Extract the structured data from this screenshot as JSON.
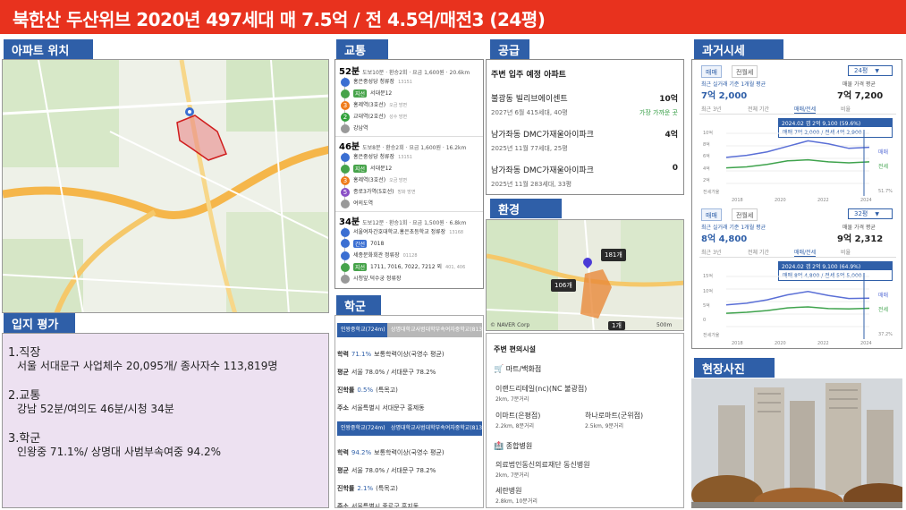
{
  "title": "북한산 두산위브 2020년 497세대 매 7.5억 / 전 4.5억/매전3 (24평)",
  "colors": {
    "title_bg": "#e8321e",
    "header_bg": "#2f5fa8",
    "eval_bg": "#ede1f1"
  },
  "location": {
    "header": "아파트 위치",
    "map_icons": [
      "road-map",
      "red-area-marker",
      "pin-icon"
    ]
  },
  "eval": {
    "header": "입지 평가",
    "job_head": "1.직장",
    "job_text": "서울 서대문구 사업체수 20,095개/ 종사자수 113,819명",
    "traffic_head": "2.교통",
    "traffic_text": "강남 52분/여의도  46분/시청  34분",
    "school_head": "3.학군",
    "school_text": "인왕중  71.1%/ 상명대 사범부속여중  94.2%"
  },
  "transport": {
    "header": "교통",
    "routes": [
      {
        "time": "52분",
        "meta": "도보10분 · 환승2회 · 요금 1,600원 · 20.6km",
        "steps": [
          {
            "n": "",
            "text": "홍은중성당 청류장",
            "sub": "13151",
            "color": "#3b6fd2"
          },
          {
            "n": "",
            "text": "서대문12",
            "sub": "",
            "color": "#46a34a",
            "tag": "지선"
          },
          {
            "n": "3",
            "text": "홍제역(3호선)",
            "sub": "오금 방면",
            "color": "#ef7c1c"
          },
          {
            "n": "2",
            "text": "교대역(2호선)",
            "sub": "성수 방면",
            "color": "#33a23d"
          },
          {
            "n": "",
            "text": "강남역",
            "sub": "",
            "color": "#999"
          }
        ]
      },
      {
        "time": "46분",
        "meta": "도보8분 · 환승2회 · 요금 1,600원 · 16.2km",
        "steps": [
          {
            "n": "",
            "text": "홍은중성당 청류장",
            "sub": "13151",
            "color": "#3b6fd2"
          },
          {
            "n": "",
            "text": "서대문12",
            "sub": "",
            "color": "#46a34a",
            "tag": "지선"
          },
          {
            "n": "3",
            "text": "홍제역(3호선)",
            "sub": "오금 방면",
            "color": "#ef7c1c"
          },
          {
            "n": "5",
            "text": "종로3가역(5호선)",
            "sub": "방화 방면",
            "color": "#8a4fc6"
          },
          {
            "n": "",
            "text": "여의도역",
            "sub": "",
            "color": "#999"
          }
        ]
      },
      {
        "time": "34분",
        "meta": "도보12분 · 환승1회 · 요금 1,500원 · 6.8km",
        "steps": [
          {
            "n": "",
            "text": "서울여자간호대학교.홍은초등학교 정류장",
            "sub": "13168",
            "color": "#3b6fd2"
          },
          {
            "n": "",
            "text": "7018",
            "sub": "",
            "color": "#3b6fd2",
            "tag": "간선"
          },
          {
            "n": "",
            "text": "세종문화회관 정류장",
            "sub": "01128",
            "color": "#3b6fd2"
          },
          {
            "n": "",
            "text": "1711, 7016, 7022, 7212 외",
            "sub": "401, 406",
            "color": "#46a34a",
            "tag": "지선"
          },
          {
            "n": "",
            "text": "시청앞.덕수궁 정류장",
            "sub": "",
            "color": "#999"
          }
        ]
      }
    ]
  },
  "school": {
    "header": "학군",
    "blocks": [
      {
        "tab1": "인왕중학교(724m)",
        "tab2": "상명대학교사범대학부속여자중학교(813m)",
        "rate_label": "학력",
        "rate": "71.1%",
        "rate_desc": "보통학력이상(국영수 평균)",
        "avg_label": "평균",
        "avg": "서울 78.0% / 서대문구 78.2%",
        "adv_label": "진학률",
        "adv": "0.5%",
        "adv_desc": "(특목고)",
        "addr_label": "주소",
        "addr": "서울특별시 서대문구 홍제동"
      },
      {
        "tab1": "인왕중학교(724m)",
        "tab2": "상명대학교사범대학부속여자중학교(813m)",
        "rate_label": "학력",
        "rate": "94.2%",
        "rate_desc": "보통학력이상(국영수 평균)",
        "avg_label": "평균",
        "avg": "서울 78.0% / 서대문구 78.2%",
        "adv_label": "진학률",
        "adv": "2.1%",
        "adv_desc": "(특목고)",
        "addr_label": "주소",
        "addr": "서울특별시 종로구 홍지동"
      }
    ]
  },
  "supply": {
    "header": "공급",
    "subtitle": "주변 입주 예정 아파트",
    "items": [
      {
        "name": "불광동 빌리브에이센트",
        "count": "10억",
        "date": "2027년 6월 415세대, 40평",
        "note": "가장 가까운 곳"
      },
      {
        "name": "남가좌동 DMC가재울아이파크",
        "count": "4억",
        "date": "2025년 11월 77세대, 25평",
        "note": ""
      },
      {
        "name": "남가좌동 DMC가재울아이파크",
        "count": "0",
        "date": "2025년 11월 283세대, 33평",
        "note": ""
      }
    ]
  },
  "env": {
    "header": "환경",
    "map_labels": {
      "c1": "181개",
      "c2": "106개",
      "c3": "1개",
      "naver": "© NAVER Corp",
      "scale": "500m"
    },
    "conv_title": "주변 편의시설",
    "mart_label": "마트/백화점",
    "marts": [
      {
        "name": "이랜드리테일(nc)(NC 불광점)",
        "dist": "2km, 7분거리"
      },
      {
        "name": "이마트(은평점)",
        "dist": "2.2km, 8분거리"
      },
      {
        "name": "하나로마트(군위점)",
        "dist": "2.5km, 9분거리"
      }
    ],
    "hosp_label": "종합병원",
    "hospitals": [
      {
        "name": "의료법인동신의료재단 동신병원",
        "dist": "2km, 7분거리"
      },
      {
        "name": "세란병원",
        "dist": "2.8km, 10분거리"
      }
    ]
  },
  "history": {
    "header": "과거시세",
    "panels": [
      {
        "tab1": "매매",
        "tab2": "전월세",
        "size": "24평",
        "left_label": "최근 실거래 기준 1개월 평균",
        "left_value": "7억 2,000",
        "right_label": "매물 가격 평균",
        "right_value": "7억 7,200",
        "periods": [
          "최근 3년",
          "전체 기간",
          "매매/전세",
          "비율"
        ],
        "tip1": "2024.02  갭 2억 9,100 (59.6%)",
        "tip2": "매매 7억 2,000 / 전세 4억 2,900",
        "yticks": [
          "10억",
          "8억",
          "6억",
          "4억",
          "2억",
          "전세가율"
        ],
        "xticks": [
          "2018",
          "2020",
          "2022",
          "2024"
        ],
        "legend_sale": "매매",
        "legend_jeonse": "전세",
        "legend_ratio": "51.7%",
        "sale": [
          5.2,
          5.6,
          6.3,
          7.4,
          8.5,
          7.9,
          7.0,
          7.2
        ],
        "jeonse": [
          3.1,
          3.3,
          3.8,
          4.5,
          4.7,
          4.3,
          4.1,
          4.3
        ]
      },
      {
        "tab1": "매매",
        "tab2": "전월세",
        "size": "32평",
        "left_label": "최근 실거래 기준 1개월 평균",
        "left_value": "8억 4,800",
        "right_label": "매물 가격 평균",
        "right_value": "9억 2,312",
        "periods": [
          "최근 3년",
          "전체 기간",
          "매매/전세",
          "비율"
        ],
        "tip1": "2024.02  갭 2억 9,100 (64.9%)",
        "tip2": "매매 8억 4,800 / 전세 5억 5,000",
        "yticks": [
          "15억",
          "10억",
          "5억",
          "0",
          "전세가율"
        ],
        "xticks": [
          "2018",
          "2020",
          "2022",
          "2024"
        ],
        "legend_sale": "매매",
        "legend_jeonse": "전세",
        "legend_ratio": "37.2%",
        "sale": [
          6.5,
          7.0,
          8.0,
          9.5,
          10.5,
          9.3,
          8.4,
          8.5
        ],
        "jeonse": [
          4.0,
          4.3,
          4.8,
          5.6,
          5.9,
          5.4,
          5.3,
          5.5
        ]
      }
    ]
  },
  "site_photo": {
    "header": "현장사진"
  }
}
